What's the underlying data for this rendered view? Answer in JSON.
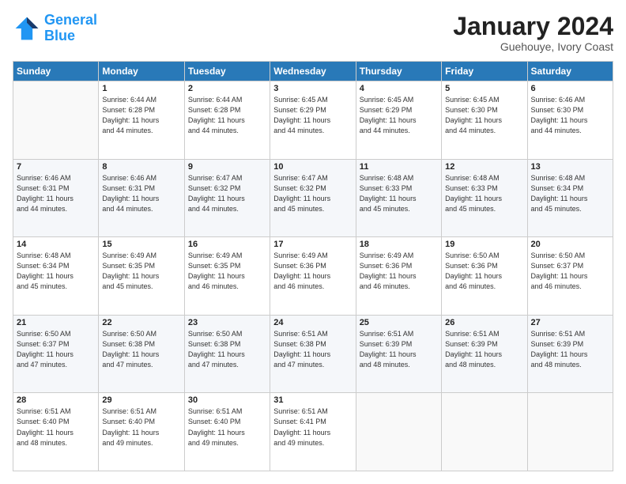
{
  "header": {
    "logo_line1": "General",
    "logo_line2": "Blue",
    "month": "January 2024",
    "location": "Guehouye, Ivory Coast"
  },
  "weekdays": [
    "Sunday",
    "Monday",
    "Tuesday",
    "Wednesday",
    "Thursday",
    "Friday",
    "Saturday"
  ],
  "weeks": [
    [
      {
        "day": "",
        "sunrise": "",
        "sunset": "",
        "daylight": ""
      },
      {
        "day": "1",
        "sunrise": "Sunrise: 6:44 AM",
        "sunset": "Sunset: 6:28 PM",
        "daylight": "Daylight: 11 hours and 44 minutes."
      },
      {
        "day": "2",
        "sunrise": "Sunrise: 6:44 AM",
        "sunset": "Sunset: 6:28 PM",
        "daylight": "Daylight: 11 hours and 44 minutes."
      },
      {
        "day": "3",
        "sunrise": "Sunrise: 6:45 AM",
        "sunset": "Sunset: 6:29 PM",
        "daylight": "Daylight: 11 hours and 44 minutes."
      },
      {
        "day": "4",
        "sunrise": "Sunrise: 6:45 AM",
        "sunset": "Sunset: 6:29 PM",
        "daylight": "Daylight: 11 hours and 44 minutes."
      },
      {
        "day": "5",
        "sunrise": "Sunrise: 6:45 AM",
        "sunset": "Sunset: 6:30 PM",
        "daylight": "Daylight: 11 hours and 44 minutes."
      },
      {
        "day": "6",
        "sunrise": "Sunrise: 6:46 AM",
        "sunset": "Sunset: 6:30 PM",
        "daylight": "Daylight: 11 hours and 44 minutes."
      }
    ],
    [
      {
        "day": "7",
        "sunrise": "Sunrise: 6:46 AM",
        "sunset": "Sunset: 6:31 PM",
        "daylight": "Daylight: 11 hours and 44 minutes."
      },
      {
        "day": "8",
        "sunrise": "Sunrise: 6:46 AM",
        "sunset": "Sunset: 6:31 PM",
        "daylight": "Daylight: 11 hours and 44 minutes."
      },
      {
        "day": "9",
        "sunrise": "Sunrise: 6:47 AM",
        "sunset": "Sunset: 6:32 PM",
        "daylight": "Daylight: 11 hours and 44 minutes."
      },
      {
        "day": "10",
        "sunrise": "Sunrise: 6:47 AM",
        "sunset": "Sunset: 6:32 PM",
        "daylight": "Daylight: 11 hours and 45 minutes."
      },
      {
        "day": "11",
        "sunrise": "Sunrise: 6:48 AM",
        "sunset": "Sunset: 6:33 PM",
        "daylight": "Daylight: 11 hours and 45 minutes."
      },
      {
        "day": "12",
        "sunrise": "Sunrise: 6:48 AM",
        "sunset": "Sunset: 6:33 PM",
        "daylight": "Daylight: 11 hours and 45 minutes."
      },
      {
        "day": "13",
        "sunrise": "Sunrise: 6:48 AM",
        "sunset": "Sunset: 6:34 PM",
        "daylight": "Daylight: 11 hours and 45 minutes."
      }
    ],
    [
      {
        "day": "14",
        "sunrise": "Sunrise: 6:48 AM",
        "sunset": "Sunset: 6:34 PM",
        "daylight": "Daylight: 11 hours and 45 minutes."
      },
      {
        "day": "15",
        "sunrise": "Sunrise: 6:49 AM",
        "sunset": "Sunset: 6:35 PM",
        "daylight": "Daylight: 11 hours and 45 minutes."
      },
      {
        "day": "16",
        "sunrise": "Sunrise: 6:49 AM",
        "sunset": "Sunset: 6:35 PM",
        "daylight": "Daylight: 11 hours and 46 minutes."
      },
      {
        "day": "17",
        "sunrise": "Sunrise: 6:49 AM",
        "sunset": "Sunset: 6:36 PM",
        "daylight": "Daylight: 11 hours and 46 minutes."
      },
      {
        "day": "18",
        "sunrise": "Sunrise: 6:49 AM",
        "sunset": "Sunset: 6:36 PM",
        "daylight": "Daylight: 11 hours and 46 minutes."
      },
      {
        "day": "19",
        "sunrise": "Sunrise: 6:50 AM",
        "sunset": "Sunset: 6:36 PM",
        "daylight": "Daylight: 11 hours and 46 minutes."
      },
      {
        "day": "20",
        "sunrise": "Sunrise: 6:50 AM",
        "sunset": "Sunset: 6:37 PM",
        "daylight": "Daylight: 11 hours and 46 minutes."
      }
    ],
    [
      {
        "day": "21",
        "sunrise": "Sunrise: 6:50 AM",
        "sunset": "Sunset: 6:37 PM",
        "daylight": "Daylight: 11 hours and 47 minutes."
      },
      {
        "day": "22",
        "sunrise": "Sunrise: 6:50 AM",
        "sunset": "Sunset: 6:38 PM",
        "daylight": "Daylight: 11 hours and 47 minutes."
      },
      {
        "day": "23",
        "sunrise": "Sunrise: 6:50 AM",
        "sunset": "Sunset: 6:38 PM",
        "daylight": "Daylight: 11 hours and 47 minutes."
      },
      {
        "day": "24",
        "sunrise": "Sunrise: 6:51 AM",
        "sunset": "Sunset: 6:38 PM",
        "daylight": "Daylight: 11 hours and 47 minutes."
      },
      {
        "day": "25",
        "sunrise": "Sunrise: 6:51 AM",
        "sunset": "Sunset: 6:39 PM",
        "daylight": "Daylight: 11 hours and 48 minutes."
      },
      {
        "day": "26",
        "sunrise": "Sunrise: 6:51 AM",
        "sunset": "Sunset: 6:39 PM",
        "daylight": "Daylight: 11 hours and 48 minutes."
      },
      {
        "day": "27",
        "sunrise": "Sunrise: 6:51 AM",
        "sunset": "Sunset: 6:39 PM",
        "daylight": "Daylight: 11 hours and 48 minutes."
      }
    ],
    [
      {
        "day": "28",
        "sunrise": "Sunrise: 6:51 AM",
        "sunset": "Sunset: 6:40 PM",
        "daylight": "Daylight: 11 hours and 48 minutes."
      },
      {
        "day": "29",
        "sunrise": "Sunrise: 6:51 AM",
        "sunset": "Sunset: 6:40 PM",
        "daylight": "Daylight: 11 hours and 49 minutes."
      },
      {
        "day": "30",
        "sunrise": "Sunrise: 6:51 AM",
        "sunset": "Sunset: 6:40 PM",
        "daylight": "Daylight: 11 hours and 49 minutes."
      },
      {
        "day": "31",
        "sunrise": "Sunrise: 6:51 AM",
        "sunset": "Sunset: 6:41 PM",
        "daylight": "Daylight: 11 hours and 49 minutes."
      },
      {
        "day": "",
        "sunrise": "",
        "sunset": "",
        "daylight": ""
      },
      {
        "day": "",
        "sunrise": "",
        "sunset": "",
        "daylight": ""
      },
      {
        "day": "",
        "sunrise": "",
        "sunset": "",
        "daylight": ""
      }
    ]
  ]
}
